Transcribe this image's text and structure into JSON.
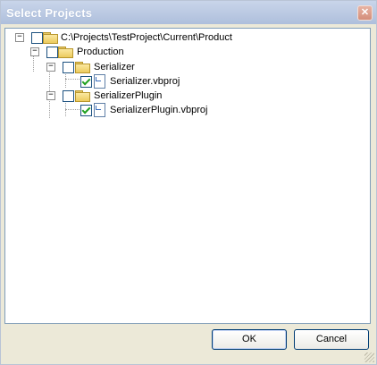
{
  "window": {
    "title": "Select Projects"
  },
  "tree": {
    "root": {
      "label": "C:\\Projects\\TestProject\\Current\\Product",
      "expander": "−",
      "checked": false
    },
    "production": {
      "label": "Production",
      "expander": "−",
      "checked": false
    },
    "serializer": {
      "label": "Serializer",
      "expander": "−",
      "checked": false
    },
    "serializer_file": {
      "label": "Serializer.vbproj",
      "checked": true
    },
    "plugin": {
      "label": "SerializerPlugin",
      "expander": "−",
      "checked": false
    },
    "plugin_file": {
      "label": "SerializerPlugin.vbproj",
      "checked": true
    }
  },
  "buttons": {
    "ok": "OK",
    "cancel": "Cancel"
  }
}
